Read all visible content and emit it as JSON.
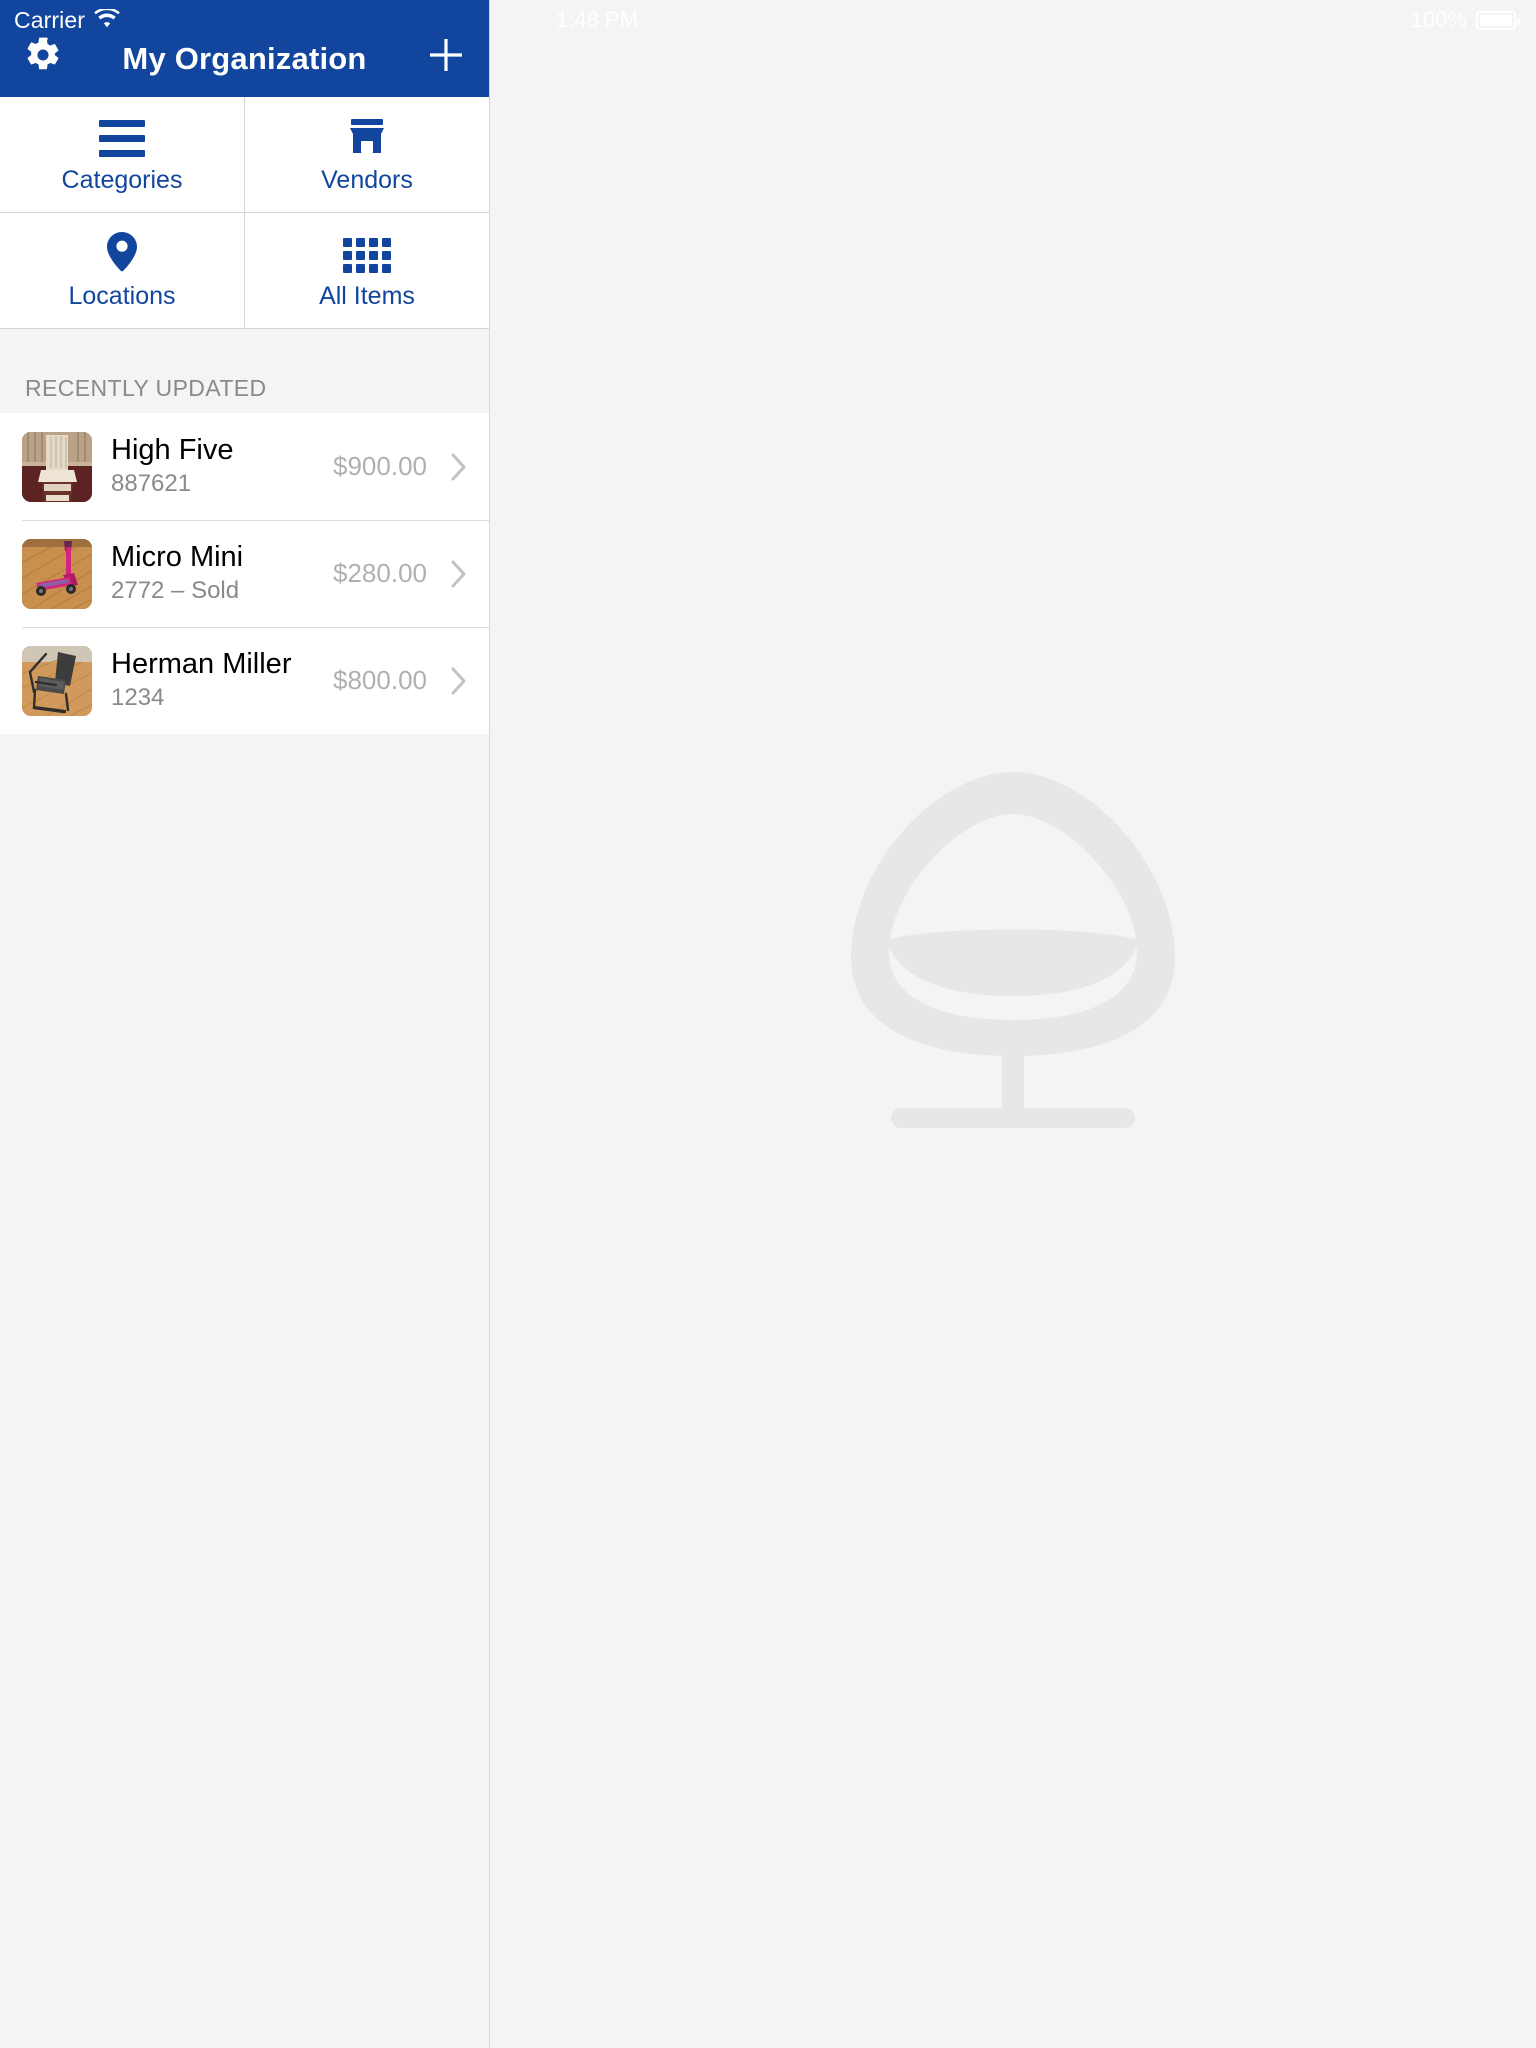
{
  "status_bar": {
    "carrier": "Carrier",
    "wifi_icon": "wifi-icon",
    "time": "1:48 PM",
    "battery_percent": "100%",
    "battery_icon": "battery-full-icon"
  },
  "navbar": {
    "title": "My Organization",
    "settings_icon": "gear-icon",
    "add_icon": "plus-icon",
    "background": "#12469e"
  },
  "shortcuts": [
    {
      "label": "Categories",
      "icon": "bars-icon"
    },
    {
      "label": "Vendors",
      "icon": "storefront-icon"
    },
    {
      "label": "Locations",
      "icon": "map-pin-icon"
    },
    {
      "label": "All Items",
      "icon": "grid-icon"
    }
  ],
  "section": {
    "recently_updated_title": "RECENTLY UPDATED"
  },
  "items": [
    {
      "title": "High Five",
      "subtitle": "887621",
      "price": "$900.00",
      "thumbnail": "white-wooden-chair-photo",
      "chevron_icon": "chevron-right-icon"
    },
    {
      "title": "Micro Mini",
      "subtitle": "2772 – Sold",
      "price": "$280.00",
      "thumbnail": "pink-scooter-photo",
      "chevron_icon": "chevron-right-icon"
    },
    {
      "title": "Herman Miller",
      "subtitle": "1234",
      "price": "$800.00",
      "thumbnail": "black-office-chair-photo",
      "chevron_icon": "chevron-right-icon"
    }
  ],
  "detail_pane": {
    "placeholder_icon": "egg-chair-placeholder-icon",
    "placeholder_color": "#e7e7e7",
    "background": "#f4f4f4"
  },
  "colors": {
    "brand_blue": "#12469e",
    "page_background": "#f4f4f4",
    "list_background": "#ffffff",
    "muted_text": "#8a8a8e",
    "price_text": "#b0b0b0"
  }
}
